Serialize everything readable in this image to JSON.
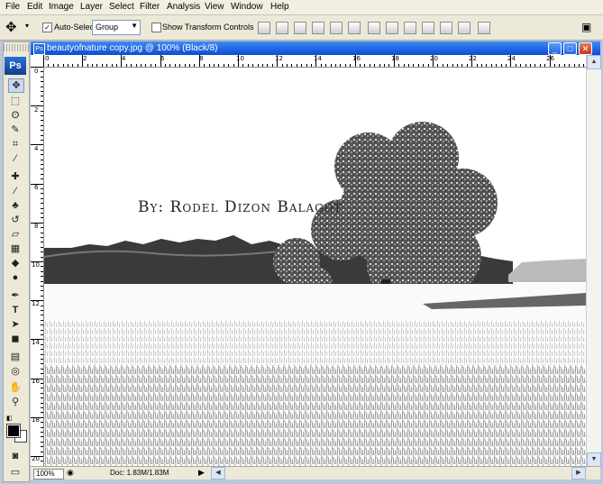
{
  "menu": [
    "File",
    "Edit",
    "Image",
    "Layer",
    "Select",
    "Filter",
    "Analysis",
    "View",
    "Window",
    "Help"
  ],
  "options": {
    "auto_select_label": "Auto-Select:",
    "auto_select_value": "Group",
    "transform_label": "Show Transform Controls"
  },
  "toolbox": {
    "logo": "Ps",
    "tools": [
      "move-tool",
      "marquee-tool",
      "lasso-tool",
      "quick-select-tool",
      "crop-tool",
      "eyedropper-tool",
      "healing-brush-tool",
      "brush-tool",
      "clone-stamp-tool",
      "history-brush-tool",
      "eraser-tool",
      "gradient-tool",
      "blur-tool",
      "dodge-tool",
      "pen-tool",
      "type-tool",
      "path-select-tool",
      "shape-tool",
      "notes-tool",
      "3d-tool",
      "hand-tool",
      "zoom-tool"
    ]
  },
  "document": {
    "title": "beautyofnature copy.jpg @ 100% (Black/8)",
    "overlay_text": "By: Rodel Dizon Balagot",
    "zoom": "100%",
    "doc_size": "Doc: 1.83M/1.83M"
  },
  "ruler": {
    "h": [
      "0",
      "2",
      "4",
      "6",
      "8",
      "10",
      "12",
      "14",
      "16",
      "18",
      "20",
      "22",
      "24",
      "26"
    ],
    "v": [
      "0",
      "2",
      "4",
      "6",
      "8",
      "10",
      "12",
      "14",
      "16",
      "18",
      "20"
    ]
  },
  "colors": {
    "titlebar": "#0e4cd0",
    "workspace": "#b9c9dd",
    "foreground": "#000000",
    "background": "#ffffff"
  }
}
